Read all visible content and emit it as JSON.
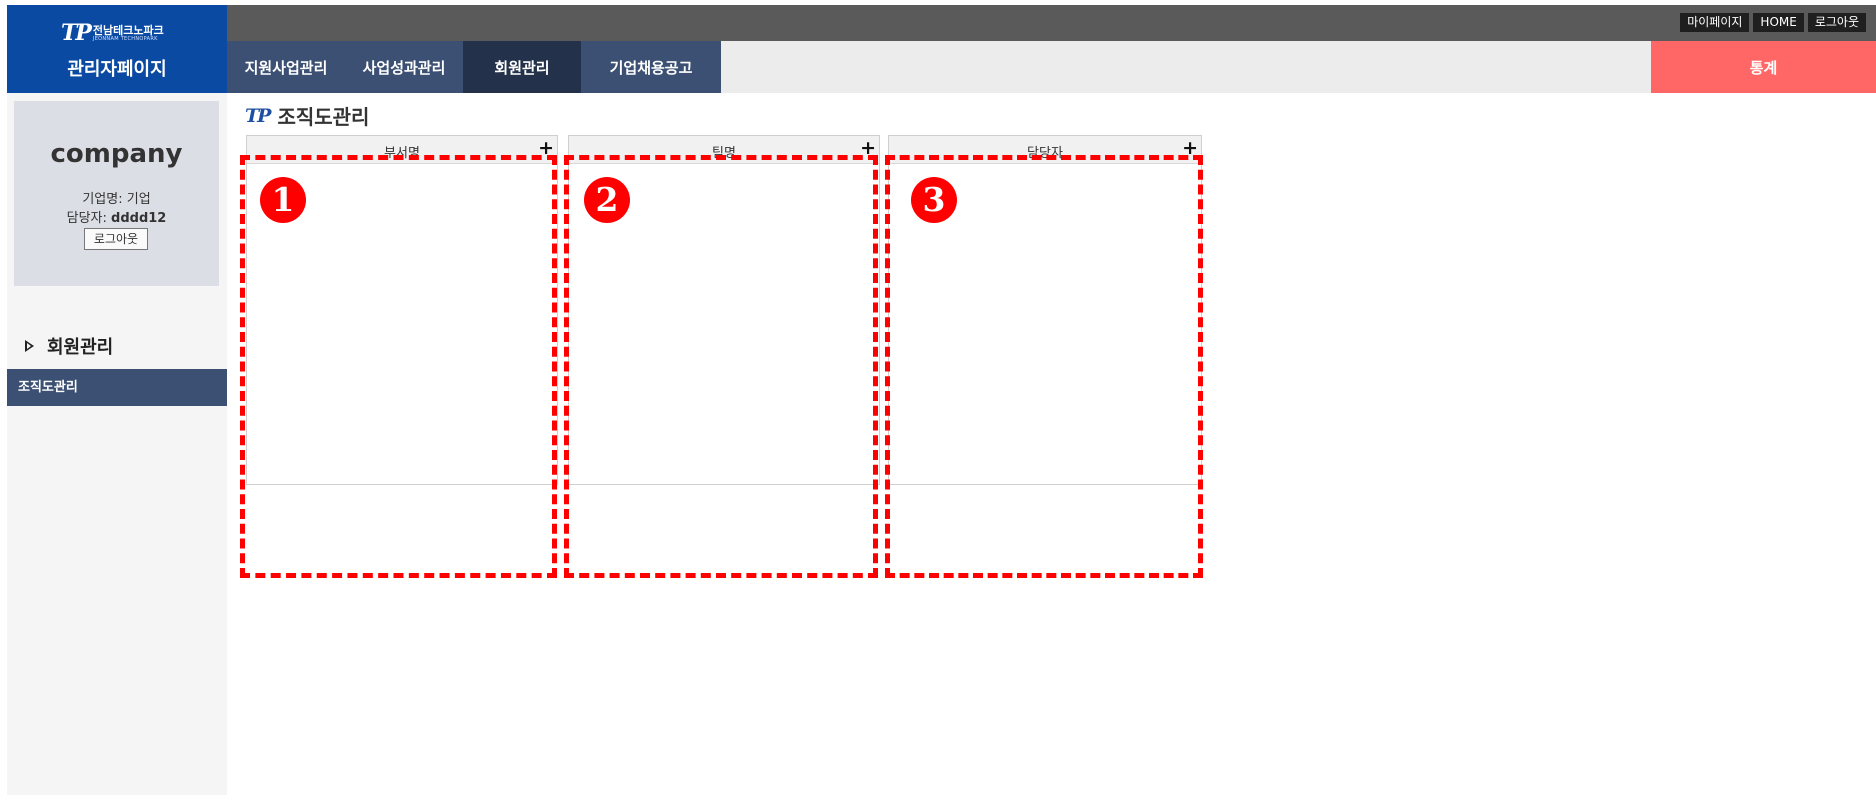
{
  "logo": {
    "mark": "TP",
    "korean": "전남테크노파크",
    "english": "JEONNAM TECHNOPARK"
  },
  "admin_title": "관리자페이지",
  "top_links": [
    "마이페이지",
    "HOME",
    "로그아웃"
  ],
  "nav": {
    "tabs": [
      "지원사업관리",
      "사업성과관리",
      "회원관리",
      "기업채용공고"
    ],
    "active": "회원관리",
    "stats": "통계"
  },
  "profile": {
    "name": "company",
    "company_label": "기업명: 기업",
    "manager_prefix": "담당자: ",
    "manager_value": "dddd12",
    "logout": "로그아웃"
  },
  "sidebar": {
    "section_title": "회원관리",
    "items": [
      "조직도관리"
    ]
  },
  "page": {
    "logo_mark": "TP",
    "title": "조직도관리"
  },
  "panels": [
    {
      "title": "부서명",
      "add_symbol": "+",
      "annotation": "1"
    },
    {
      "title": "팀명",
      "add_symbol": "+",
      "annotation": "2"
    },
    {
      "title": "담당자",
      "add_symbol": "+",
      "annotation": "3"
    }
  ],
  "colors": {
    "brand_blue": "#0b4aa2",
    "nav_tab": "#3b5072",
    "nav_tab_active": "#23314a",
    "stats": "#ff6666",
    "annotation_red": "#ff0000"
  }
}
